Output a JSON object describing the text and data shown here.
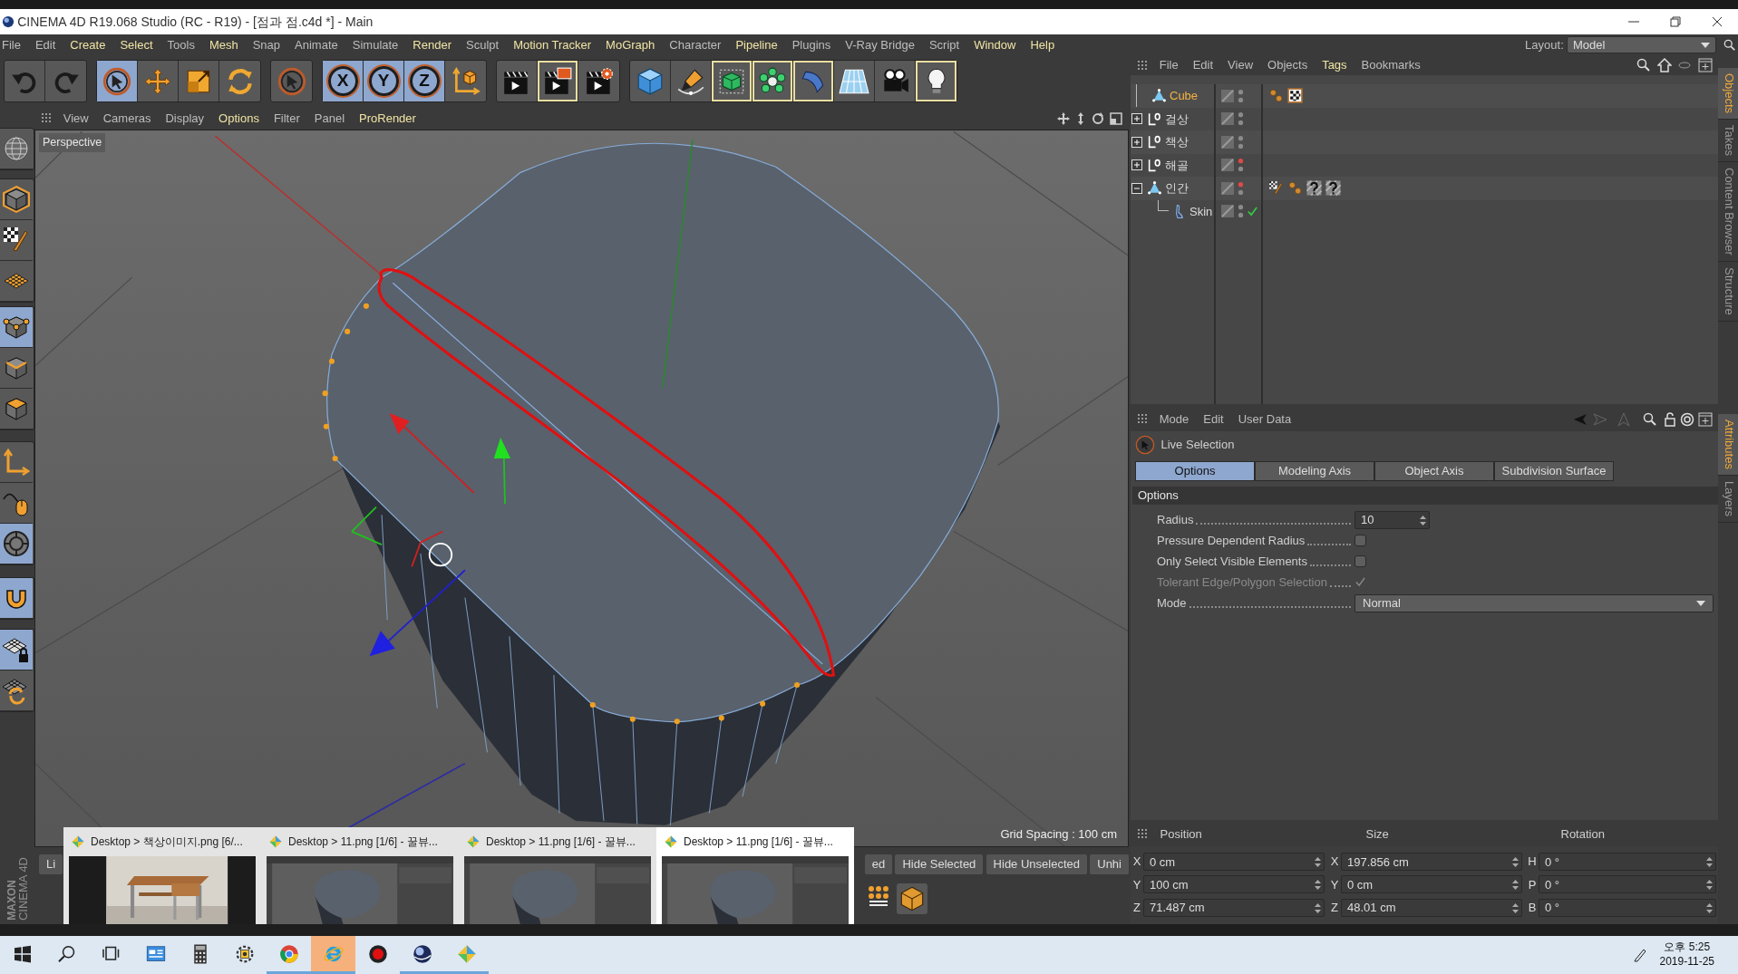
{
  "window": {
    "title": "CINEMA 4D R19.068 Studio (RC - R19) - [점과 점.c4d *] - Main"
  },
  "menu": [
    {
      "label": "File",
      "highlighted": false
    },
    {
      "label": "Edit",
      "highlighted": false
    },
    {
      "label": "Create",
      "highlighted": true
    },
    {
      "label": "Select",
      "highlighted": true
    },
    {
      "label": "Tools",
      "highlighted": false
    },
    {
      "label": "Mesh",
      "highlighted": true
    },
    {
      "label": "Snap",
      "highlighted": false
    },
    {
      "label": "Animate",
      "highlighted": false
    },
    {
      "label": "Simulate",
      "highlighted": false
    },
    {
      "label": "Render",
      "highlighted": true
    },
    {
      "label": "Sculpt",
      "highlighted": false
    },
    {
      "label": "Motion Tracker",
      "highlighted": true
    },
    {
      "label": "MoGraph",
      "highlighted": true
    },
    {
      "label": "Character",
      "highlighted": false
    },
    {
      "label": "Pipeline",
      "highlighted": true
    },
    {
      "label": "Plugins",
      "highlighted": false
    },
    {
      "label": "V-Ray Bridge",
      "highlighted": false
    },
    {
      "label": "Script",
      "highlighted": false
    },
    {
      "label": "Window",
      "highlighted": true
    },
    {
      "label": "Help",
      "highlighted": true
    }
  ],
  "layout": {
    "label": "Layout:",
    "value": "Model"
  },
  "toolbar": [
    {
      "items": [
        {
          "kind": "undo",
          "selected": false,
          "highlighted": false
        },
        {
          "kind": "redo",
          "selected": false,
          "highlighted": false
        }
      ]
    },
    {
      "items": [
        {
          "kind": "live-selection",
          "selected": true,
          "highlighted": false
        },
        {
          "kind": "move",
          "selected": false,
          "highlighted": false
        },
        {
          "kind": "scale",
          "selected": false,
          "highlighted": false
        },
        {
          "kind": "rotate",
          "selected": false,
          "highlighted": false
        }
      ]
    },
    {
      "items": [
        {
          "kind": "last-tool",
          "selected": false,
          "highlighted": false
        }
      ]
    },
    {
      "items": [
        {
          "kind": "axis",
          "label": "X",
          "selected": true,
          "highlighted": false
        },
        {
          "kind": "axis",
          "label": "Y",
          "selected": true,
          "highlighted": false
        },
        {
          "kind": "axis",
          "label": "Z",
          "selected": true,
          "highlighted": false
        },
        {
          "kind": "coordinate-system",
          "selected": false,
          "highlighted": false
        }
      ]
    },
    {
      "items": [
        {
          "kind": "render-view",
          "selected": false,
          "highlighted": false
        },
        {
          "kind": "render-picture-viewer",
          "selected": false,
          "highlighted": true
        },
        {
          "kind": "render-settings",
          "selected": false,
          "highlighted": false
        }
      ]
    },
    {
      "items": [
        {
          "kind": "cube",
          "selected": false,
          "highlighted": false
        },
        {
          "kind": "pen",
          "selected": false,
          "highlighted": false
        },
        {
          "kind": "subdivision",
          "selected": false,
          "highlighted": true
        },
        {
          "kind": "cloner",
          "selected": false,
          "highlighted": true
        },
        {
          "kind": "bend",
          "selected": false,
          "highlighted": true
        },
        {
          "kind": "floor",
          "selected": false,
          "highlighted": false
        },
        {
          "kind": "camera",
          "selected": false,
          "highlighted": false
        },
        {
          "kind": "light",
          "selected": false,
          "highlighted": true
        }
      ]
    }
  ],
  "left_toolbar": [
    {
      "items": [
        {
          "kind": "globe",
          "selected": false
        }
      ]
    },
    {
      "items": [
        {
          "kind": "model",
          "selected": false
        },
        {
          "kind": "texture",
          "selected": false
        },
        {
          "kind": "workplane",
          "selected": false
        }
      ]
    },
    {
      "items": [
        {
          "kind": "points",
          "selected": true
        },
        {
          "kind": "edges",
          "selected": false
        },
        {
          "kind": "polygons",
          "selected": false
        }
      ]
    },
    {
      "items": [
        {
          "kind": "axis-mode",
          "selected": false
        },
        {
          "kind": "tweak",
          "selected": false
        },
        {
          "kind": "solo",
          "selected": true
        }
      ]
    },
    {
      "items": [
        {
          "kind": "snap",
          "selected": true
        }
      ]
    },
    {
      "items": [
        {
          "kind": "lock-workplane",
          "selected": true
        },
        {
          "kind": "planar-workplane",
          "selected": false
        }
      ]
    }
  ],
  "viewport": {
    "menu": [
      {
        "label": "View",
        "highlighted": false
      },
      {
        "label": "Cameras",
        "highlighted": false
      },
      {
        "label": "Display",
        "highlighted": false
      },
      {
        "label": "Options",
        "highlighted": true
      },
      {
        "label": "Filter",
        "highlighted": false
      },
      {
        "label": "Panel",
        "highlighted": false
      },
      {
        "label": "ProRender",
        "highlighted": true
      }
    ],
    "camera": "Perspective",
    "grid_spacing": "Grid Spacing : 100 cm"
  },
  "object_manager": {
    "menu": [
      {
        "label": "File",
        "highlighted": false
      },
      {
        "label": "Edit",
        "highlighted": false
      },
      {
        "label": "View",
        "highlighted": false
      },
      {
        "label": "Objects",
        "highlighted": false
      },
      {
        "label": "Tags",
        "highlighted": true
      },
      {
        "label": "Bookmarks",
        "highlighted": false
      }
    ],
    "objects": [
      {
        "name": "Cube",
        "kind": "polygon",
        "selected": true,
        "editor_hidden": false,
        "checked": false,
        "tags": [
          {
            "kind": "phong"
          },
          {
            "kind": "material"
          }
        ]
      },
      {
        "name": "걸상",
        "kind": "null",
        "selected": false,
        "expanded": false,
        "editor_hidden": false,
        "checked": false
      },
      {
        "name": "책상",
        "kind": "null",
        "selected": false,
        "expanded": false,
        "editor_hidden": false,
        "checked": false
      },
      {
        "name": "해골",
        "kind": "null",
        "selected": false,
        "expanded": false,
        "editor_hidden": true,
        "checked": false
      },
      {
        "name": "인간",
        "kind": "polygon",
        "selected": false,
        "expanded": true,
        "editor_hidden": true,
        "checked": false,
        "tags": [
          {
            "kind": "texture"
          },
          {
            "kind": "phong"
          },
          {
            "kind": "unknown"
          },
          {
            "kind": "unknown"
          }
        ],
        "children": [
          {
            "name": "Skin",
            "kind": "skin",
            "selected": false,
            "editor_hidden": false,
            "checked": true
          }
        ]
      }
    ]
  },
  "side_tabs_top": [
    {
      "label": "Objects",
      "selected": true
    },
    {
      "label": "Takes",
      "selected": false
    },
    {
      "label": "Content Browser",
      "selected": false
    },
    {
      "label": "Structure",
      "selected": false
    }
  ],
  "side_tabs_bottom": [
    {
      "label": "Attributes",
      "selected": true
    },
    {
      "label": "Layers",
      "selected": false
    }
  ],
  "attributes": {
    "menu": [
      {
        "label": "Mode",
        "highlighted": false
      },
      {
        "label": "Edit",
        "highlighted": false
      },
      {
        "label": "User Data",
        "highlighted": false
      }
    ],
    "tool": "Live Selection",
    "tabs": [
      {
        "label": "Options",
        "selected": true
      },
      {
        "label": "Modeling Axis",
        "selected": false
      },
      {
        "label": "Object Axis",
        "selected": false
      },
      {
        "label": "Subdivision Surface",
        "selected": false
      }
    ],
    "section": "Options",
    "fields": [
      {
        "kind": "number",
        "label": "Radius",
        "value": "10"
      },
      {
        "kind": "checkbox",
        "label": "Pressure Dependent Radius",
        "checked": false,
        "disabled": false
      },
      {
        "kind": "checkbox",
        "label": "Only Select Visible Elements",
        "checked": false,
        "disabled": false
      },
      {
        "kind": "checkbox",
        "label": "Tolerant Edge/Polygon Selection",
        "checked": true,
        "disabled": true
      },
      {
        "kind": "dropdown",
        "label": "Mode",
        "value": "Normal"
      }
    ]
  },
  "coordinates": {
    "columns": [
      {
        "title": "Position",
        "fields": [
          {
            "axis": "X",
            "value": "0 cm"
          },
          {
            "axis": "Y",
            "value": "100 cm"
          },
          {
            "axis": "Z",
            "value": "71.487 cm"
          }
        ]
      },
      {
        "title": "Size",
        "fields": [
          {
            "axis": "X",
            "value": "197.856 cm"
          },
          {
            "axis": "Y",
            "value": "0 cm"
          },
          {
            "axis": "Z",
            "value": "48.01 cm"
          }
        ]
      },
      {
        "title": "Rotation",
        "fields": [
          {
            "axis": "H",
            "value": "0 °"
          },
          {
            "axis": "P",
            "value": "0 °"
          },
          {
            "axis": "B",
            "value": "0 °"
          }
        ]
      }
    ]
  },
  "bottom_buttons": [
    {
      "label": "Li"
    },
    {
      "label": "ed"
    },
    {
      "label": "Hide Selected"
    },
    {
      "label": "Hide Unselected"
    },
    {
      "label": "Unhi"
    }
  ],
  "logo": {
    "brand": "MAXON",
    "product": "CINEMA 4D"
  },
  "previews": [
    {
      "title": "Desktop > 책상이미지.png [6/...",
      "selected": false
    },
    {
      "title": "Desktop > 11.png [1/6] - 꿀뷰...",
      "kind": "screen",
      "selected": false
    },
    {
      "title": "Desktop > 11.png [1/6] - 꿀뷰...",
      "kind": "screen",
      "selected": false
    },
    {
      "title": "Desktop > 11.png [1/6] - 꿀뷰...",
      "kind": "screen",
      "selected": true
    }
  ],
  "taskbar": {
    "apps": [
      {
        "kind": "start",
        "running": false,
        "selected": false
      },
      {
        "kind": "search",
        "running": false,
        "selected": false
      },
      {
        "kind": "task-view",
        "running": false,
        "selected": false
      },
      {
        "kind": "app-window",
        "running": false,
        "selected": false
      },
      {
        "kind": "calculator",
        "running": false,
        "selected": false
      },
      {
        "kind": "network",
        "running": false,
        "selected": false
      },
      {
        "kind": "chrome",
        "running": true,
        "selected": false
      },
      {
        "kind": "ie",
        "running": true,
        "selected": true
      },
      {
        "kind": "record",
        "running": false,
        "selected": false
      },
      {
        "kind": "c4d",
        "running": true,
        "selected": false
      },
      {
        "kind": "honeyview",
        "running": true,
        "selected": false
      }
    ],
    "time": "오후 5:25",
    "date": "2019-11-25"
  }
}
